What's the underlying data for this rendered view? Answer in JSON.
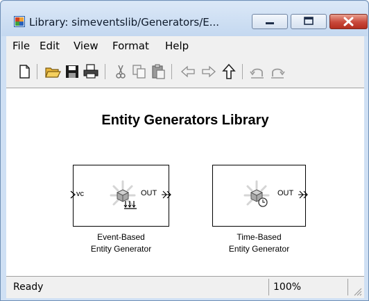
{
  "window": {
    "title": "Library: simeventslib/Generators/E..."
  },
  "menu": [
    "File",
    "Edit",
    "View",
    "Format",
    "Help"
  ],
  "toolbar": {
    "icons": [
      "new-document-icon",
      "open-folder-icon",
      "save-icon",
      "print-icon",
      "cut-icon",
      "copy-icon",
      "paste-icon",
      "back-icon",
      "forward-icon",
      "up-icon",
      "undo-icon",
      "redo-icon"
    ]
  },
  "library": {
    "title": "Entity Generators Library",
    "blocks": [
      {
        "name_line1": "Event-Based",
        "name_line2": "Entity Generator",
        "input_port": "vc",
        "output_port": "OUT"
      },
      {
        "name_line1": "Time-Based",
        "name_line2": "Entity Generator",
        "output_port": "OUT"
      }
    ]
  },
  "status": {
    "text": "Ready",
    "zoom": "100%"
  },
  "colors": {
    "titlebar": "#c4d8f0",
    "close_button": "#c8483a",
    "chrome": "#f0f0f0"
  }
}
